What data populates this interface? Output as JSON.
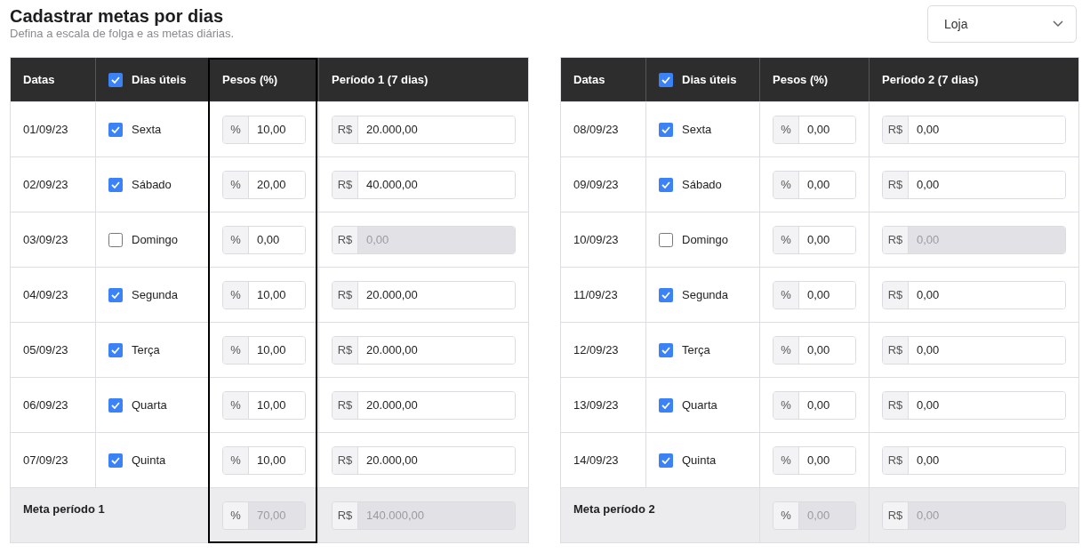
{
  "header": {
    "title": "Cadastrar metas por dias",
    "subtitle": "Defina a escala de folga e as metas diárias.",
    "store_select": {
      "value": "Loja"
    }
  },
  "tables": [
    {
      "highlighted": true,
      "columns": [
        "Datas",
        "Dias úteis",
        "Pesos (%)",
        "Período 1 (7 dias)"
      ],
      "all_checked": true,
      "rows": [
        {
          "date": "01/09/23",
          "day": "Sexta",
          "checked": true,
          "weight_unit": "%",
          "weight": "10,00",
          "goal_unit": "R$",
          "goal": "20.000,00",
          "goal_disabled": false
        },
        {
          "date": "02/09/23",
          "day": "Sábado",
          "checked": true,
          "weight_unit": "%",
          "weight": "20,00",
          "goal_unit": "R$",
          "goal": "40.000,00",
          "goal_disabled": false
        },
        {
          "date": "03/09/23",
          "day": "Domingo",
          "checked": false,
          "weight_unit": "%",
          "weight": "0,00",
          "goal_unit": "R$",
          "goal": "0,00",
          "goal_disabled": true
        },
        {
          "date": "04/09/23",
          "day": "Segunda",
          "checked": true,
          "weight_unit": "%",
          "weight": "10,00",
          "goal_unit": "R$",
          "goal": "20.000,00",
          "goal_disabled": false
        },
        {
          "date": "05/09/23",
          "day": "Terça",
          "checked": true,
          "weight_unit": "%",
          "weight": "10,00",
          "goal_unit": "R$",
          "goal": "20.000,00",
          "goal_disabled": false
        },
        {
          "date": "06/09/23",
          "day": "Quarta",
          "checked": true,
          "weight_unit": "%",
          "weight": "10,00",
          "goal_unit": "R$",
          "goal": "20.000,00",
          "goal_disabled": false
        },
        {
          "date": "07/09/23",
          "day": "Quinta",
          "checked": true,
          "weight_unit": "%",
          "weight": "10,00",
          "goal_unit": "R$",
          "goal": "20.000,00",
          "goal_disabled": false
        }
      ],
      "footer": {
        "label": "Meta período 1",
        "weight_unit": "%",
        "weight": "70,00",
        "goal_unit": "R$",
        "goal": "140.000,00"
      }
    },
    {
      "highlighted": false,
      "columns": [
        "Datas",
        "Dias úteis",
        "Pesos (%)",
        "Período 2 (7 dias)"
      ],
      "all_checked": true,
      "rows": [
        {
          "date": "08/09/23",
          "day": "Sexta",
          "checked": true,
          "weight_unit": "%",
          "weight": "0,00",
          "goal_unit": "R$",
          "goal": "0,00",
          "goal_disabled": false
        },
        {
          "date": "09/09/23",
          "day": "Sábado",
          "checked": true,
          "weight_unit": "%",
          "weight": "0,00",
          "goal_unit": "R$",
          "goal": "0,00",
          "goal_disabled": false
        },
        {
          "date": "10/09/23",
          "day": "Domingo",
          "checked": false,
          "weight_unit": "%",
          "weight": "0,00",
          "goal_unit": "R$",
          "goal": "0,00",
          "goal_disabled": true
        },
        {
          "date": "11/09/23",
          "day": "Segunda",
          "checked": true,
          "weight_unit": "%",
          "weight": "0,00",
          "goal_unit": "R$",
          "goal": "0,00",
          "goal_disabled": false
        },
        {
          "date": "12/09/23",
          "day": "Terça",
          "checked": true,
          "weight_unit": "%",
          "weight": "0,00",
          "goal_unit": "R$",
          "goal": "0,00",
          "goal_disabled": false
        },
        {
          "date": "13/09/23",
          "day": "Quarta",
          "checked": true,
          "weight_unit": "%",
          "weight": "0,00",
          "goal_unit": "R$",
          "goal": "0,00",
          "goal_disabled": false
        },
        {
          "date": "14/09/23",
          "day": "Quinta",
          "checked": true,
          "weight_unit": "%",
          "weight": "0,00",
          "goal_unit": "R$",
          "goal": "0,00",
          "goal_disabled": false
        }
      ],
      "footer": {
        "label": "Meta período 2",
        "weight_unit": "%",
        "weight": "0,00",
        "goal_unit": "R$",
        "goal": "0,00"
      }
    }
  ]
}
